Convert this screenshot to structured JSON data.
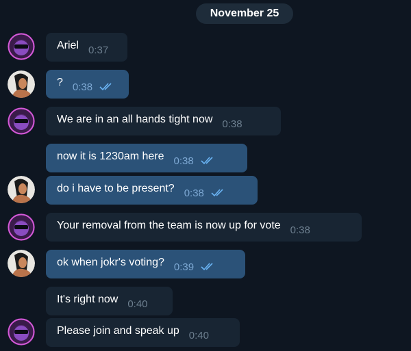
{
  "date_label": "November 25",
  "messages": [
    {
      "text": "Ariel",
      "time": "0:37"
    },
    {
      "text": "?",
      "time": "0:38"
    },
    {
      "text": "We are in an all hands tight now",
      "time": "0:38"
    },
    {
      "text": "now it is 1230am here",
      "time": "0:38"
    },
    {
      "text": "do i have to be present?",
      "time": "0:38"
    },
    {
      "text": "Your removal from the team is now up for vote",
      "time": "0:38"
    },
    {
      "text": "ok when jokr's voting?",
      "time": "0:39"
    },
    {
      "text": "It's right now",
      "time": "0:40"
    },
    {
      "text": "Please join and speak up",
      "time": "0:40"
    }
  ],
  "colors": {
    "background": "#0e1621",
    "incoming_bubble": "#182533",
    "outgoing_bubble": "#2b5278",
    "read_check": "#6ab3f3"
  },
  "icons": {
    "contact_avatar": "jester-avatar-icon",
    "own_avatar": "woman-avatar-icon",
    "read_receipt": "double-check-icon"
  }
}
